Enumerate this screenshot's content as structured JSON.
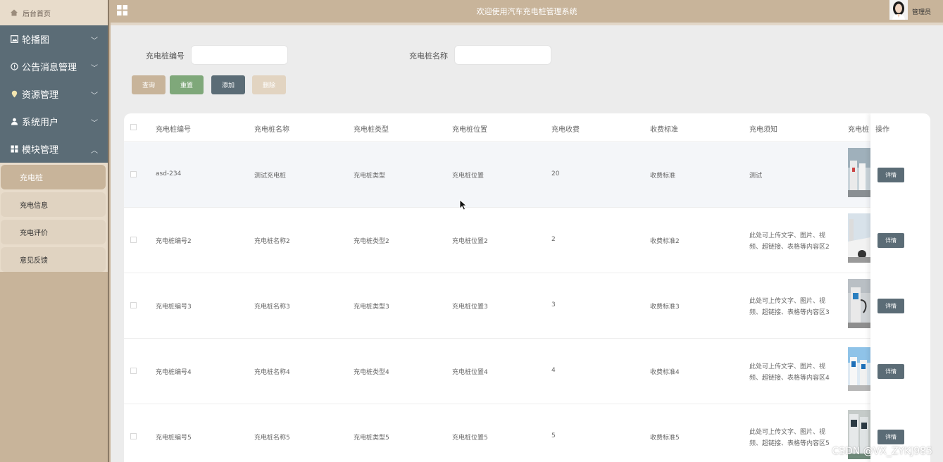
{
  "sidebar": {
    "home_label": "后台首页",
    "menus": [
      {
        "label": "轮播图",
        "icon": "image-icon"
      },
      {
        "label": "公告消息管理",
        "icon": "info-circle-icon"
      },
      {
        "label": "资源管理",
        "icon": "location-pin-icon"
      },
      {
        "label": "系统用户",
        "icon": "user-icon"
      },
      {
        "label": "模块管理",
        "icon": "grid-icon",
        "expanded": true
      }
    ],
    "submenu": [
      {
        "label": "充电桩",
        "active": true
      },
      {
        "label": "充电信息"
      },
      {
        "label": "充电评价"
      },
      {
        "label": "意见反馈"
      }
    ]
  },
  "header": {
    "title": "欢迎使用汽车充电桩管理系统",
    "user": "管理员"
  },
  "search": {
    "code_label": "充电桩编号",
    "code_value": "",
    "name_label": "充电桩名称",
    "name_value": ""
  },
  "buttons": {
    "query": "查询",
    "reset": "重置",
    "add": "添加",
    "delete": "删除"
  },
  "colors": {
    "primary": "#c8b49a",
    "sidebar_menu": "#5b6c76",
    "reset_btn": "#7fa87a",
    "add_btn": "#5b6c76",
    "delete_btn_disabled": "#e2d4c1"
  },
  "table": {
    "columns": [
      "充电桩编号",
      "充电桩名称",
      "充电桩类型",
      "充电桩位置",
      "充电收费",
      "收费标准",
      "充电须知",
      "充电桩",
      "操作"
    ],
    "rows": [
      {
        "code": "asd-234",
        "name": "测试充电桩",
        "type": "充电桩类型",
        "location": "充电桩位置",
        "fee": "20",
        "standard": "收费标准",
        "notice1": "测试",
        "notice2": ""
      },
      {
        "code": "充电桩编号2",
        "name": "充电桩名称2",
        "type": "充电桩类型2",
        "location": "充电桩位置2",
        "fee": "2",
        "standard": "收费标准2",
        "notice1": "此处可上传文字、图片、视",
        "notice2": "频、超链接、表格等内容区2"
      },
      {
        "code": "充电桩编号3",
        "name": "充电桩名称3",
        "type": "充电桩类型3",
        "location": "充电桩位置3",
        "fee": "3",
        "standard": "收费标准3",
        "notice1": "此处可上传文字、图片、视",
        "notice2": "频、超链接、表格等内容区3"
      },
      {
        "code": "充电桩编号4",
        "name": "充电桩名称4",
        "type": "充电桩类型4",
        "location": "充电桩位置4",
        "fee": "4",
        "standard": "收费标准4",
        "notice1": "此处可上传文字、图片、视",
        "notice2": "频、超链接、表格等内容区4"
      },
      {
        "code": "充电桩编号5",
        "name": "充电桩名称5",
        "type": "充电桩类型5",
        "location": "充电桩位置5",
        "fee": "5",
        "standard": "收费标准5",
        "notice1": "此处可上传文字、图片、视",
        "notice2": "频、超链接、表格等内容区5"
      }
    ],
    "detail_label": "详情"
  },
  "watermark": "CSDN @VX_ZYKJ985"
}
